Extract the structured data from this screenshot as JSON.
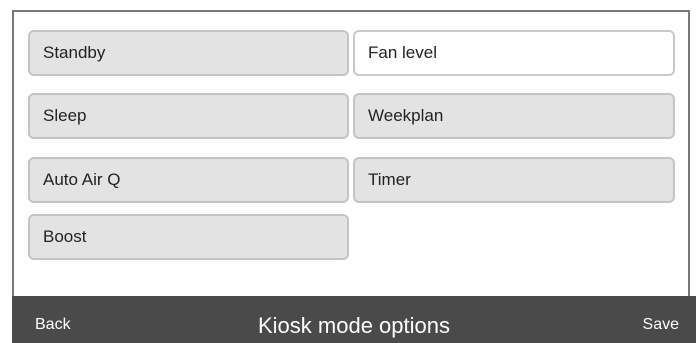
{
  "options": [
    {
      "label": "Standby",
      "selected": false
    },
    {
      "label": "Fan level",
      "selected": true
    },
    {
      "label": "Sleep",
      "selected": false
    },
    {
      "label": "Weekplan",
      "selected": false
    },
    {
      "label": "Auto Air Q",
      "selected": false
    },
    {
      "label": "Timer",
      "selected": false
    },
    {
      "label": "Boost",
      "selected": false
    }
  ],
  "footer": {
    "back_label": "Back",
    "title": "Kiosk mode options",
    "save_label": "Save"
  },
  "colors": {
    "option_bg": "#e3e3e3",
    "option_selected_bg": "#ffffff",
    "footer_bg": "#4a4a4a"
  }
}
